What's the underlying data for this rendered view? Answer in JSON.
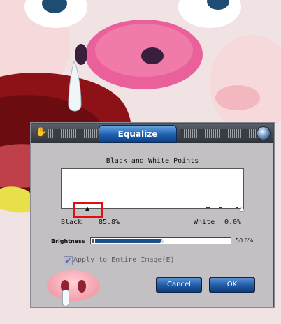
{
  "dialog": {
    "title": "Equalize",
    "section_title": "Black and White Points",
    "black_label": "Black",
    "black_value": "85.8%",
    "white_label": "White",
    "white_value": "0.0%",
    "brightness_label": "Brightness",
    "brightness_value": "50.0%",
    "brightness_level": 0.5,
    "apply_label": "Apply to Entire Image(E)",
    "apply_checked": true,
    "cancel_label": "Cancel",
    "ok_label": "OK"
  },
  "colors": {
    "accent_blue": "#1f5aa5",
    "highlight_red": "#e01010",
    "dialog_bg": "#c3c0c3"
  },
  "icons": [
    "hand-icon",
    "orb-icon",
    "pig-snout-logo"
  ]
}
